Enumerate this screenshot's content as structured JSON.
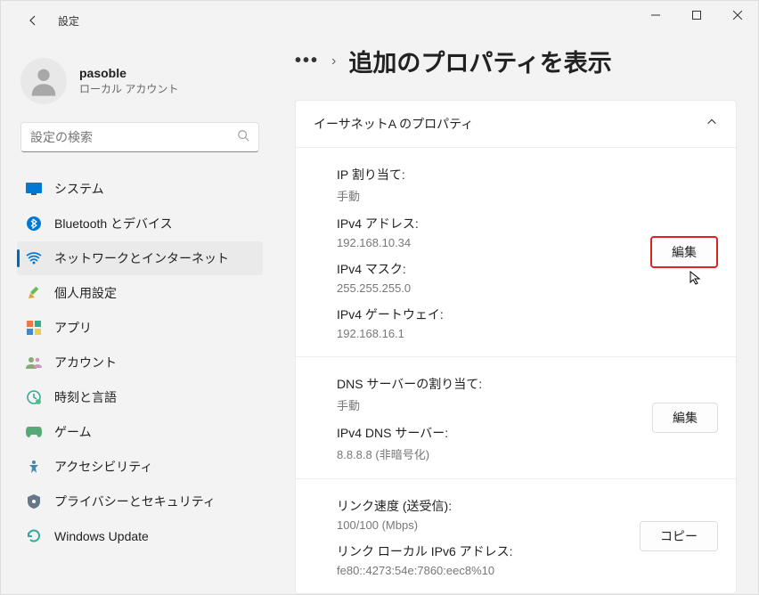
{
  "window": {
    "title": "設定"
  },
  "user": {
    "name": "pasoble",
    "type": "ローカル アカウント"
  },
  "search": {
    "placeholder": "設定の検索"
  },
  "sidebar": {
    "items": [
      {
        "label": "システム",
        "icon": "system-icon"
      },
      {
        "label": "Bluetooth とデバイス",
        "icon": "bluetooth-icon"
      },
      {
        "label": "ネットワークとインターネット",
        "icon": "network-icon"
      },
      {
        "label": "個人用設定",
        "icon": "personalize-icon"
      },
      {
        "label": "アプリ",
        "icon": "apps-icon"
      },
      {
        "label": "アカウント",
        "icon": "accounts-icon"
      },
      {
        "label": "時刻と言語",
        "icon": "time-icon"
      },
      {
        "label": "ゲーム",
        "icon": "gaming-icon"
      },
      {
        "label": "アクセシビリティ",
        "icon": "accessibility-icon"
      },
      {
        "label": "プライバシーとセキュリティ",
        "icon": "privacy-icon"
      },
      {
        "label": "Windows Update",
        "icon": "update-icon"
      }
    ],
    "active_index": 2
  },
  "breadcrumb": {
    "ellipsis": "•••",
    "chevron": "›",
    "page_title": "追加のプロパティを表示"
  },
  "card": {
    "title": "イーサネットA のプロパティ"
  },
  "sections": [
    {
      "button": "編集",
      "button_highlight": true,
      "rows": [
        {
          "label": "IP 割り当て:",
          "value": "手動"
        },
        {
          "label": "IPv4 アドレス:",
          "value": "192.168.10.34"
        },
        {
          "label": "IPv4 マスク:",
          "value": "255.255.255.0"
        },
        {
          "label": "IPv4 ゲートウェイ:",
          "value": "192.168.16.1"
        }
      ]
    },
    {
      "button": "編集",
      "button_highlight": false,
      "rows": [
        {
          "label": "DNS サーバーの割り当て:",
          "value": "手動"
        },
        {
          "label": "IPv4 DNS サーバー:",
          "value": "8.8.8.8 (非暗号化)"
        }
      ]
    },
    {
      "button": "コピー",
      "button_highlight": false,
      "rows": [
        {
          "label": "リンク速度 (送受信):",
          "value": "100/100 (Mbps)"
        },
        {
          "label": "リンク ローカル IPv6 アドレス:",
          "value": "fe80::4273:54e:7860:eec8%10"
        }
      ]
    }
  ]
}
